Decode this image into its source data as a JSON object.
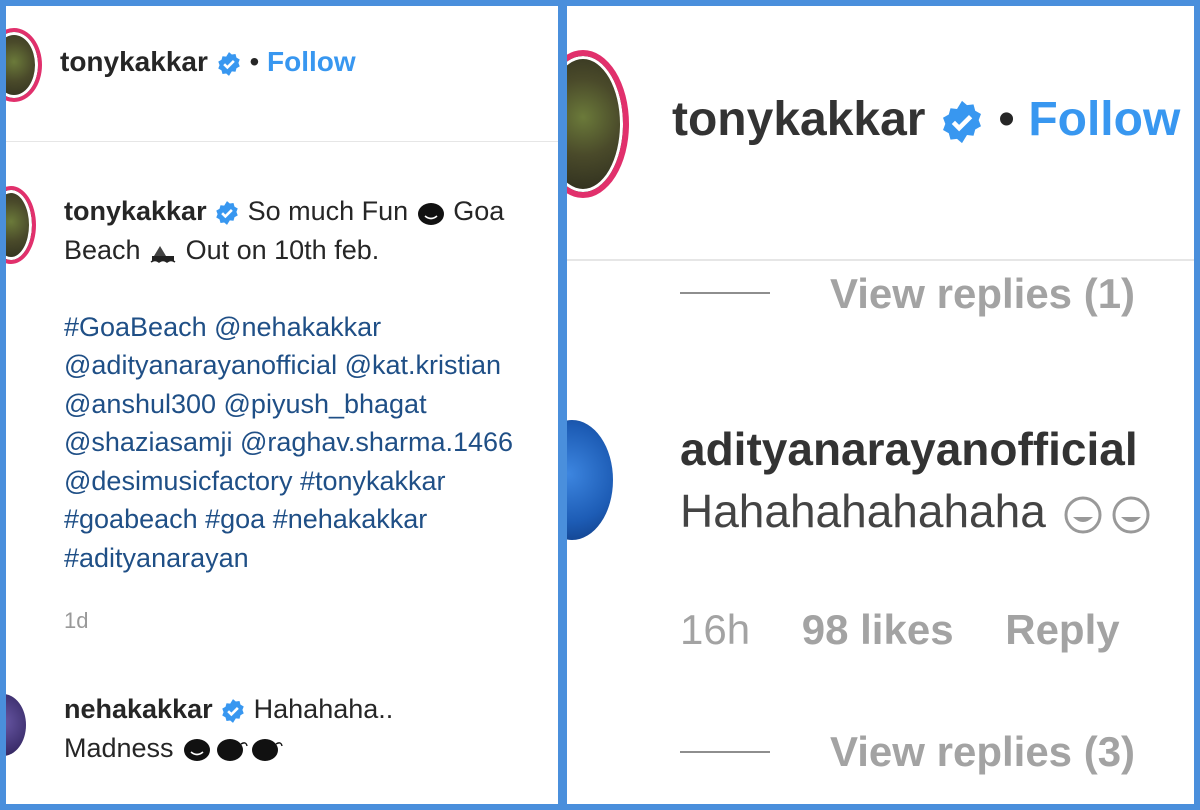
{
  "left": {
    "header": {
      "username": "tonykakkar",
      "separator": "•",
      "follow_label": "Follow"
    },
    "caption": {
      "username": "tonykakkar",
      "line1_text": "So much Fun",
      "line1_tail": "Goa",
      "line2_text": "Beach",
      "line2_tail": "Out on 10th feb.",
      "tag_lines": [
        "#GoaBeach @nehakakkar",
        "@adityanarayanofficial @kat.kristian",
        "@anshul300 @piyush_bhagat",
        "@shaziasamji @raghav.sharma.1466",
        "@desimusicfactory #tonykakkar",
        "#goabeach #goa #nehakakkar",
        "#adityanarayan"
      ],
      "time": "1d"
    },
    "comment": {
      "username": "nehakakkar",
      "text_line1": "Hahahaha..",
      "text_line2": "Madness"
    }
  },
  "right": {
    "header": {
      "username": "tonykakkar",
      "separator": "•",
      "follow_label": "Follow"
    },
    "view_replies_1": "View replies (1)",
    "comment": {
      "username": "adityanarayanofficial",
      "text": "Hahahahahahaha",
      "time": "16h",
      "likes": "98 likes",
      "reply": "Reply"
    },
    "view_replies_2": "View replies (3)"
  },
  "colors": {
    "frame": "#4a8fdc",
    "follow": "#3897f0",
    "verified": "#3897f0",
    "story_ring": "#e1306c",
    "hashtag": "#1f4f86",
    "muted": "#999999"
  }
}
